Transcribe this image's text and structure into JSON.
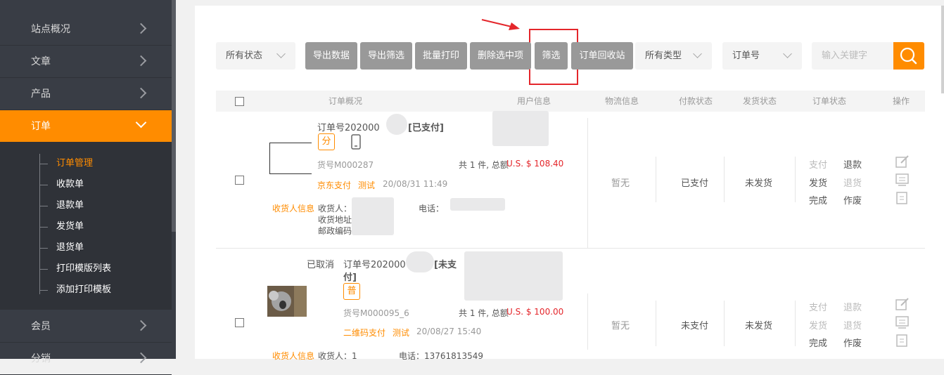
{
  "sidebar": {
    "items": [
      "站点概况",
      "文章",
      "产品",
      "订单",
      "会员",
      "分销"
    ],
    "sub_items": [
      "订单管理",
      "收款单",
      "退款单",
      "发货单",
      "退货单",
      "打印模版列表",
      "添加打印模板"
    ]
  },
  "toolbar": {
    "status_select": "所有状态",
    "export_data": "导出数据",
    "export_filter": "导出筛选",
    "batch_print": "批量打印",
    "delete_selected": "删除选中项",
    "filter": "筛选",
    "recycle": "订单回收站",
    "type_select": "所有类型",
    "field_select": "订单号",
    "search_placeholder": "输入关键字"
  },
  "table_headers": [
    "订单概况",
    "用户信息",
    "物流信息",
    "付款状态",
    "发货状态",
    "订单状态",
    "操作"
  ],
  "orders": [
    {
      "order_no": "订单号202000",
      "pay_tag": "[已支付]",
      "badge": "分",
      "sku": "货号M000287",
      "summary": "共 1 件, 总额",
      "amount": "U.S. $ 108.40",
      "pay_method": "京东支付",
      "test": "测试",
      "date": "20/08/31 11:49",
      "receiver_label": "收货人信息",
      "receiver": "收货人：",
      "phone": "电话：",
      "address": "收货地址：",
      "zip": "邮政编码：",
      "logistics": "暂无",
      "payment": "已支付",
      "shipping": "未发货",
      "actions": [
        "支付",
        "退款",
        "发货",
        "退货",
        "完成",
        "作废"
      ]
    },
    {
      "cancelled": "已取消",
      "order_no": "订单号202000",
      "pay_tag_a": "[未支",
      "pay_tag_b": "付]",
      "badge": "普",
      "sku": "货号M000095_6",
      "summary": "共 1 件, 总额",
      "amount": "U.S. $ 100.00",
      "pay_method": "二维码支付",
      "test": "测试",
      "date": "20/08/27 15:40",
      "receiver_label": "收货人信息",
      "receiver": "收货人：1",
      "phone": "电话：13761813549",
      "logistics": "暂无",
      "payment": "未支付",
      "shipping": "未发货",
      "actions": [
        "支付",
        "退款",
        "发货",
        "退货",
        "完成",
        "作废"
      ]
    }
  ],
  "colors": {
    "accent": "#ff8c00",
    "sidebar": "#393d45",
    "button": "#999999",
    "highlight": "#e4262b"
  }
}
